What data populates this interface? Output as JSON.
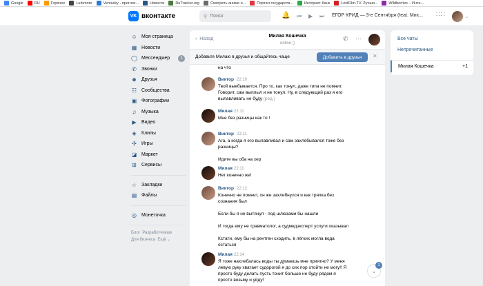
{
  "bookmarks": [
    {
      "label": "Google",
      "icon": "google-icon",
      "color": "#4285f4"
    },
    {
      "label": "RU",
      "icon": "youtube-icon",
      "color": "#ff0000"
    },
    {
      "label": "Горячее",
      "icon": "pikabu-icon",
      "color": "#ff9900"
    },
    {
      "label": "Lurkmore",
      "icon": "lurkmore-icon",
      "color": "#444444"
    },
    {
      "label": "Ventusky - прогноз...",
      "icon": "ventusky-icon",
      "color": "#2c7bd3"
    },
    {
      "label": "Новости",
      "icon": "news-icon",
      "color": "#2a5885"
    },
    {
      "label": "RuTracker.org",
      "icon": "rutracker-icon",
      "color": "#4a7a3a"
    },
    {
      "label": "Смотреть аниме о...",
      "icon": "anime-icon",
      "color": "#6a6a6a"
    },
    {
      "label": "Портал государств...",
      "icon": "gosuslugi-icon",
      "color": "#e0383e"
    },
    {
      "label": "Интернет-банк",
      "icon": "bank-icon",
      "color": "#2aa84a"
    },
    {
      "label": "LostFilm.TV. Лучши...",
      "icon": "lostfilm-icon",
      "color": "#d21f26"
    },
    {
      "label": "Wildberries – Инте...",
      "icon": "wildberries-icon",
      "color": "#8b2aa8"
    }
  ],
  "header": {
    "logo_letters": "VK",
    "logo_text": "вконтакте",
    "search_placeholder": "Поиск",
    "now_playing": "ЕГОР КРИД — 3-е Сентября (feat. Мих..."
  },
  "sidebar": {
    "items": [
      {
        "label": "Моя страница",
        "icon": "user-icon",
        "glyph": "☺"
      },
      {
        "label": "Новости",
        "icon": "news-icon",
        "glyph": "▦"
      },
      {
        "label": "Мессенджер",
        "icon": "message-icon",
        "glyph": "◯",
        "badge": "1"
      },
      {
        "label": "Звонки",
        "icon": "phone-icon",
        "glyph": "✆"
      },
      {
        "label": "Друзья",
        "icon": "friends-icon",
        "glyph": "☻"
      },
      {
        "label": "Сообщества",
        "icon": "community-icon",
        "glyph": "☷"
      },
      {
        "label": "Фотографии",
        "icon": "photo-icon",
        "glyph": "▣"
      },
      {
        "label": "Музыка",
        "icon": "music-icon",
        "glyph": "♫"
      },
      {
        "label": "Видео",
        "icon": "video-icon",
        "glyph": "▶"
      },
      {
        "label": "Клипы",
        "icon": "clips-icon",
        "glyph": "◈"
      },
      {
        "label": "Игры",
        "icon": "games-icon",
        "glyph": "✣"
      },
      {
        "label": "Маркет",
        "icon": "market-icon",
        "glyph": "◪"
      },
      {
        "label": "Сервисы",
        "icon": "services-icon",
        "glyph": "⊞"
      }
    ],
    "items2": [
      {
        "label": "Закладки",
        "icon": "bookmark-icon",
        "glyph": "☆"
      },
      {
        "label": "Файлы",
        "icon": "file-icon",
        "glyph": "▤"
      }
    ],
    "items3": [
      {
        "label": "Монеточка",
        "icon": "coin-icon",
        "glyph": "◎"
      }
    ],
    "footer": {
      "blog": "Блог",
      "dev": "Разработчикам",
      "business": "Для бизнеса",
      "more": "Ещё ⌄"
    }
  },
  "chat": {
    "back": "Назад",
    "title": "Милая Кошечка",
    "status": "online",
    "banner_text": "Добавьте Милаю в друзья и общайтесь чаще",
    "banner_button": "Добавить в друзья",
    "messages": [
      {
        "author": "",
        "time": "",
        "lines": [
          "на что"
        ]
      },
      {
        "author": "Виктор",
        "time": "22:10",
        "lines": [
          "Твой выебывается. Про то, как тонул, даже типа не помнит.",
          "Говорит, сам выплыл и не тонул. Ну, в следующий раз я его",
          "вылавливать не буду"
        ],
        "edited": "(ред.)"
      },
      {
        "author": "Милая",
        "time": "22:11",
        "lines": [
          "Мне без разницы как то !"
        ]
      },
      {
        "author": "Виктор",
        "time": "22:11",
        "lines": [
          "Ага, а когда я его вылавливал и сам захлебывался тоже без",
          "разницы?",
          "",
          "Идите вы оба на хер"
        ]
      },
      {
        "author": "Милая",
        "time": "22:11",
        "lines": [
          "Нет конечно же!"
        ]
      },
      {
        "author": "Виктор",
        "time": "22:12",
        "lines": [
          "Конечно не помнит, он же захлебнулся и как тряпка без",
          "сознания был",
          "",
          "Если бы я не вытянул - под шлюзами бы нашли",
          "",
          "И тогда ему не травматолог, а судмедэксперт услуги оказывал",
          "",
          "Кстати, ему бы на рентген сходить, в лёгких могла вода",
          "остаться"
        ]
      },
      {
        "author": "Милая",
        "time": "22:14",
        "lines": [
          "Я тоже нахлебалась воды ты думаешь мне приятно? У меня",
          "левую руку хватает судорогой я до сих пор отойти не могу!! Я",
          "просто буду делать пусть тонит больше не буду рядом я",
          "просто возьму и уйду!"
        ]
      }
    ],
    "unread": "1"
  },
  "right": {
    "all": "Все чаты",
    "unread": "Непрочитанные",
    "active": "Милая Кошечка",
    "active_count": "+1"
  }
}
